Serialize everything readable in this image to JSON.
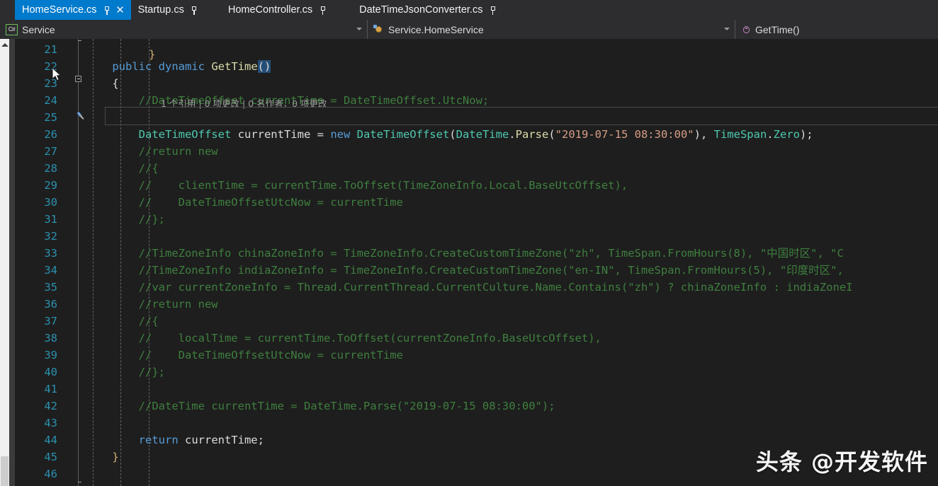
{
  "window": {
    "app": "Visual Studio",
    "theme_background": "#1e1e1e",
    "accent": "#007acc"
  },
  "tabs": [
    {
      "label": "HomeService.cs",
      "active": true,
      "pinned": true,
      "closable": true
    },
    {
      "label": "Startup.cs",
      "active": false,
      "pinned": true,
      "closable": false
    },
    {
      "label": "HomeController.cs",
      "active": false,
      "pinned": true,
      "closable": false
    },
    {
      "label": "DateTimeJsonConverter.cs",
      "active": false,
      "pinned": true,
      "closable": false
    }
  ],
  "navbar": {
    "project": "Service",
    "project_icon": "csharp-file-icon",
    "type": "Service.HomeService",
    "type_icon": "class-icon",
    "member": "GetTime()",
    "member_icon": "method-icon",
    "dropdown_icon": "chevron-down-icon"
  },
  "codelens": "1 个引用 | 0 项更改 | 0 名作者，0 项更改",
  "editor": {
    "first_line": 21,
    "quick_actions_icon": "screwdriver-icon",
    "collapse_icon": "collapse-minus-icon",
    "lines": [
      {
        "n": 21,
        "segments": []
      },
      {
        "n": 22,
        "segments": [
          {
            "t": "    ",
            "c": "id"
          },
          {
            "t": "public",
            "c": "kw"
          },
          {
            "t": " ",
            "c": "id"
          },
          {
            "t": "dynamic",
            "c": "kw"
          },
          {
            "t": " ",
            "c": "id"
          },
          {
            "t": "GetTime",
            "c": "meth"
          },
          {
            "t": "()",
            "c": "sel"
          }
        ]
      },
      {
        "n": 23,
        "segments": [
          {
            "t": "    {",
            "c": "punct"
          }
        ]
      },
      {
        "n": 24,
        "segments": [
          {
            "t": "        //DateTimeOffset currentTime = DateTimeOffset.UtcNow;",
            "c": "cmt"
          }
        ]
      },
      {
        "n": 25,
        "segments": []
      },
      {
        "n": 26,
        "segments": [
          {
            "t": "        ",
            "c": "id"
          },
          {
            "t": "DateTimeOffset",
            "c": "type"
          },
          {
            "t": " currentTime ",
            "c": "id"
          },
          {
            "t": "= ",
            "c": "punct"
          },
          {
            "t": "new ",
            "c": "kw"
          },
          {
            "t": "DateTimeOffset",
            "c": "type"
          },
          {
            "t": "(",
            "c": "punct"
          },
          {
            "t": "DateTime",
            "c": "type"
          },
          {
            "t": ".",
            "c": "punct"
          },
          {
            "t": "Parse",
            "c": "meth"
          },
          {
            "t": "(",
            "c": "punct"
          },
          {
            "t": "\"2019-07-15 08:30:00\"",
            "c": "str"
          },
          {
            "t": "), ",
            "c": "punct"
          },
          {
            "t": "TimeSpan",
            "c": "type"
          },
          {
            "t": ".",
            "c": "punct"
          },
          {
            "t": "Zero",
            "c": "type"
          },
          {
            "t": ");",
            "c": "punct"
          }
        ]
      },
      {
        "n": 27,
        "segments": [
          {
            "t": "        //return new",
            "c": "cmt"
          }
        ]
      },
      {
        "n": 28,
        "segments": [
          {
            "t": "        //{",
            "c": "cmt"
          }
        ]
      },
      {
        "n": 29,
        "segments": [
          {
            "t": "        //    clientTime = currentTime.ToOffset(TimeZoneInfo.Local.BaseUtcOffset),",
            "c": "cmt"
          }
        ]
      },
      {
        "n": 30,
        "segments": [
          {
            "t": "        //    DateTimeOffsetUtcNow = currentTime",
            "c": "cmt"
          }
        ]
      },
      {
        "n": 31,
        "segments": [
          {
            "t": "        //};",
            "c": "cmt"
          }
        ]
      },
      {
        "n": 32,
        "segments": []
      },
      {
        "n": 33,
        "segments": [
          {
            "t": "        //TimeZoneInfo chinaZoneInfo = TimeZoneInfo.CreateCustomTimeZone(\"zh\", TimeSpan.FromHours(8), \"中国时区\", \"C",
            "c": "cmt"
          }
        ]
      },
      {
        "n": 34,
        "segments": [
          {
            "t": "        //TimeZoneInfo indiaZoneInfo = TimeZoneInfo.CreateCustomTimeZone(\"en-IN\", TimeSpan.FromHours(5), \"印度时区\",",
            "c": "cmt"
          }
        ]
      },
      {
        "n": 35,
        "segments": [
          {
            "t": "        //var currentZoneInfo = Thread.CurrentThread.CurrentCulture.Name.Contains(\"zh\") ? chinaZoneInfo : indiaZoneI",
            "c": "cmt"
          }
        ]
      },
      {
        "n": 36,
        "segments": [
          {
            "t": "        //return new",
            "c": "cmt"
          }
        ]
      },
      {
        "n": 37,
        "segments": [
          {
            "t": "        //{",
            "c": "cmt"
          }
        ]
      },
      {
        "n": 38,
        "segments": [
          {
            "t": "        //    localTime = currentTime.ToOffset(currentZoneInfo.BaseUtcOffset),",
            "c": "cmt"
          }
        ]
      },
      {
        "n": 39,
        "segments": [
          {
            "t": "        //    DateTimeOffsetUtcNow = currentTime",
            "c": "cmt"
          }
        ]
      },
      {
        "n": 40,
        "segments": [
          {
            "t": "        //};",
            "c": "cmt"
          }
        ]
      },
      {
        "n": 41,
        "segments": []
      },
      {
        "n": 42,
        "segments": [
          {
            "t": "        //DateTime currentTime = DateTime.Parse(\"2019-07-15 08:30:00\");",
            "c": "cmt"
          }
        ]
      },
      {
        "n": 43,
        "segments": []
      },
      {
        "n": 44,
        "segments": [
          {
            "t": "        ",
            "c": "id"
          },
          {
            "t": "return",
            "c": "kw"
          },
          {
            "t": " currentTime;",
            "c": "id"
          }
        ]
      },
      {
        "n": 45,
        "segments": [
          {
            "t": "    }",
            "c": "brace"
          }
        ]
      },
      {
        "n": 46,
        "segments": []
      }
    ]
  },
  "watermark": "头条 @开发软件"
}
